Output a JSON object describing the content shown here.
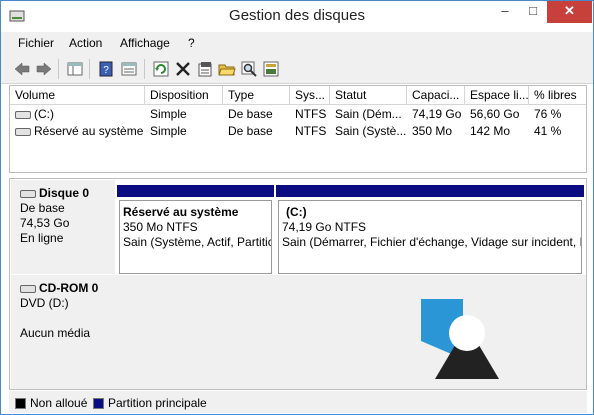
{
  "window": {
    "title": "Gestion des disques"
  },
  "window_controls": {
    "minimize": "–",
    "maximize": "□",
    "close": "✕"
  },
  "menu": [
    "Fichier",
    "Action",
    "Affichage",
    "?"
  ],
  "volumes": {
    "columns": [
      "Volume",
      "Disposition",
      "Type",
      "Sys...",
      "Statut",
      "Capaci...",
      "Espace li...",
      "% libres"
    ],
    "rows": [
      [
        "(C:)",
        "Simple",
        "De base",
        "NTFS",
        "Sain (Dém...",
        "74,19 Go",
        "56,60 Go",
        "76 %"
      ],
      [
        "Réservé au système",
        "Simple",
        "De base",
        "NTFS",
        "Sain (Systè...",
        "350 Mo",
        "142 Mo",
        "41 %"
      ]
    ]
  },
  "disks": [
    {
      "name": "Disque 0",
      "type": "De base",
      "size": "74,53 Go",
      "status": "En ligne",
      "partitions": [
        {
          "name": "Réservé au système",
          "size_fs": "350 Mo NTFS",
          "status": "Sain (Système, Actif, Partitic"
        },
        {
          "name": "(C:)",
          "size_fs": "74,19 Go NTFS",
          "status": "Sain (Démarrer, Fichier d'échange, Vidage sur incident, I"
        }
      ]
    },
    {
      "name": "CD-ROM 0",
      "type": "DVD (D:)",
      "status": "Aucun média"
    }
  ],
  "legend": [
    {
      "label": "Non alloué",
      "color": "#000000"
    },
    {
      "label": "Partition principale",
      "color": "#0c0c82"
    }
  ],
  "colors": {
    "partition_bar": "#0c0c82",
    "close_button": "#c7403b",
    "watermark": "#2a96d6"
  }
}
